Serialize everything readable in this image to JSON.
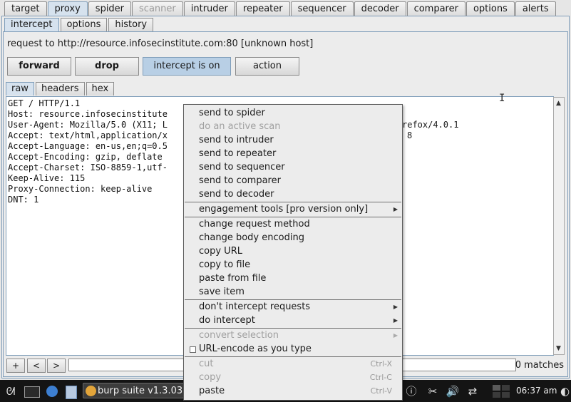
{
  "main_tabs": [
    {
      "label": "target"
    },
    {
      "label": "proxy",
      "active": true
    },
    {
      "label": "spider"
    },
    {
      "label": "scanner",
      "disabled": true
    },
    {
      "label": "intruder"
    },
    {
      "label": "repeater"
    },
    {
      "label": "sequencer"
    },
    {
      "label": "decoder"
    },
    {
      "label": "comparer"
    },
    {
      "label": "options"
    },
    {
      "label": "alerts"
    }
  ],
  "proxy_tabs": [
    "intercept",
    "options",
    "history"
  ],
  "request_info": "request to http://resource.infosecinstitute.com:80  [unknown host]",
  "buttons": {
    "forward": "forward",
    "drop": "drop",
    "intercept": "intercept is on",
    "action": "action"
  },
  "view_tabs": [
    "raw",
    "headers",
    "hex"
  ],
  "request_lines": [
    "GET / HTTP/1.1",
    "Host: resource.infosecinstitute",
    "User-Agent: Mozilla/5.0 (X11; L",
    "Accept: text/html,application/x",
    "Accept-Language: en-us,en;q=0.5",
    "Accept-Encoding: gzip, deflate",
    "Accept-Charset: ISO-8859-1,utf-",
    "Keep-Alive: 115",
    "Proxy-Connection: keep-alive",
    "DNT: 1"
  ],
  "request_overflow": {
    "line3": "refox/4.0.1",
    "line4": "8"
  },
  "find_bar": {
    "plus": "+",
    "prev": "<",
    "next": ">",
    "matches": "0 matches"
  },
  "context_menu": {
    "items": [
      {
        "label": "send to spider"
      },
      {
        "label": "do an active scan",
        "disabled": true
      },
      {
        "label": "send to intruder"
      },
      {
        "label": "send to repeater"
      },
      {
        "label": "send to sequencer"
      },
      {
        "label": "send to comparer"
      },
      {
        "label": "send to decoder"
      },
      {
        "label": "engagement tools [pro version only]",
        "submenu": true
      },
      {
        "label": "change request method"
      },
      {
        "label": "change body encoding"
      },
      {
        "label": "copy URL"
      },
      {
        "label": "copy to file"
      },
      {
        "label": "paste from file"
      },
      {
        "label": "save item"
      },
      {
        "label": "don't intercept requests",
        "submenu": true
      },
      {
        "label": "do intercept",
        "submenu": true
      },
      {
        "label": "convert selection",
        "submenu": true,
        "disabled": true
      },
      {
        "label": "URL-encode as you type",
        "checkbox": true
      },
      {
        "label": "cut",
        "accel": "Ctrl-X",
        "disabled": true
      },
      {
        "label": "copy",
        "accel": "Ctrl-C",
        "disabled": true
      },
      {
        "label": "paste",
        "accel": "Ctrl-V"
      }
    ]
  },
  "taskbar": {
    "task_label": "burp suite v1.3.03",
    "clock": "06:37 am"
  }
}
